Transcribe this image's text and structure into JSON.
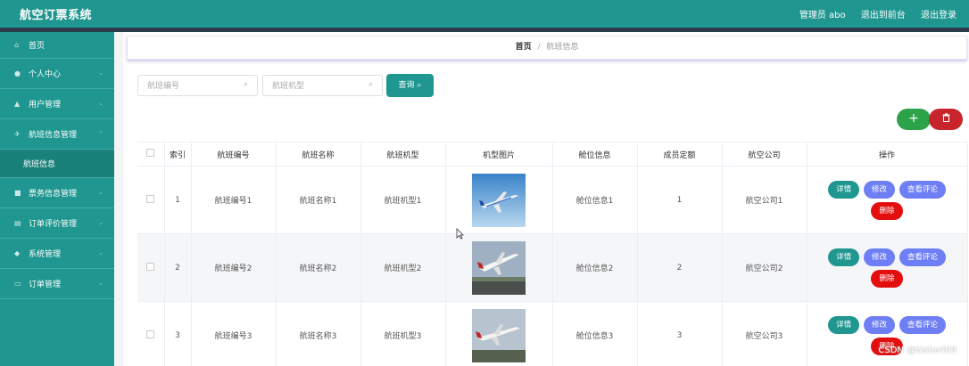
{
  "header": {
    "title": "航空订票系统",
    "user": "管理员 abo",
    "front_link": "退出到前台",
    "logout_link": "退出登录"
  },
  "sidebar": {
    "items": [
      {
        "label": "首页",
        "icon": "home-icon"
      },
      {
        "label": "个人中心",
        "icon": "user-icon"
      },
      {
        "label": "用户管理",
        "icon": "users-icon"
      },
      {
        "label": "航班信息管理",
        "icon": "plane-icon"
      },
      {
        "label": "航班信息",
        "icon": ""
      },
      {
        "label": "票务信息管理",
        "icon": "ticket-icon"
      },
      {
        "label": "订单评价管理",
        "icon": "comment-icon"
      },
      {
        "label": "系统管理",
        "icon": "gear-icon"
      },
      {
        "label": "订单管理",
        "icon": "order-icon"
      }
    ]
  },
  "breadcrumb": {
    "home": "首页",
    "separator": "/",
    "current": "航班信息"
  },
  "search": {
    "flight_no_placeholder": "航班编号",
    "flight_model_placeholder": "航班机型",
    "query_label": "查询"
  },
  "table": {
    "columns": [
      "索引",
      "航班编号",
      "航班名称",
      "航班机型",
      "机型图片",
      "舱位信息",
      "成员定额",
      "航空公司",
      "操作"
    ],
    "rows": [
      {
        "index": "1",
        "flight_no": "航班编号1",
        "flight_name": "航班名称1",
        "flight_model": "航班机型1",
        "cabin": "舱位信息1",
        "quota": "1",
        "airline": "航空公司1"
      },
      {
        "index": "2",
        "flight_no": "航班编号2",
        "flight_name": "航班名称2",
        "flight_model": "航班机型2",
        "cabin": "舱位信息2",
        "quota": "2",
        "airline": "航空公司2"
      },
      {
        "index": "3",
        "flight_no": "航班编号3",
        "flight_name": "航班名称3",
        "flight_model": "航班机型3",
        "cabin": "舱位信息3",
        "quota": "3",
        "airline": "航空公司3"
      }
    ],
    "actions": {
      "detail": "详情",
      "edit": "修改",
      "comments": "查看评论",
      "delete": "删除"
    }
  },
  "toolbar": {
    "add_icon": "plus-icon",
    "delete_icon": "trash-icon"
  },
  "watermark": "CSDN @bishe409",
  "colors": {
    "primary": "#1f9690",
    "add": "#2ca24a",
    "danger": "#c7252b",
    "action_blue": "#6e7ff5",
    "delete_red": "#e30e0e"
  }
}
